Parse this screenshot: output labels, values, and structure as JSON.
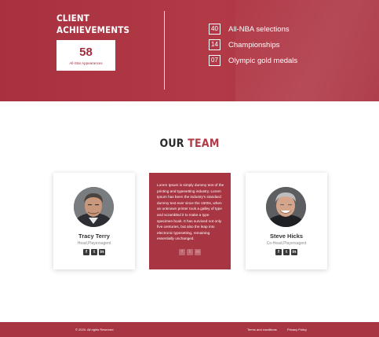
{
  "achievements": {
    "title": "CLIENT ACHIEVEMENTS",
    "highlight": {
      "number": "58",
      "label": "All-Star Appearances"
    },
    "stats": [
      {
        "number": "40",
        "label": "All-NBA selections"
      },
      {
        "number": "14",
        "label": "Championships"
      },
      {
        "number": "07",
        "label": "Olympic gold medals"
      }
    ]
  },
  "team": {
    "heading_part1": "OUR",
    "heading_part2": "TEAM",
    "members": [
      {
        "name": "Tracy Terry",
        "role": "Head,Playersagent"
      },
      {
        "name": "Steve Hicks",
        "role": "Co-Head,Playersagent"
      }
    ],
    "bio": "Lorem Ipsum is simply dummy text of the printing and typesetting industry. Lorem Ipsum has been the industry's standard dummy text ever since the 1500s, when an unknown printer took a galley of type and scrambled it to make a type specimen book. It has survived not only five centuries, but also the leap into electronic typesetting, remaining essentially unchanged.",
    "social_icons": [
      "facebook-icon",
      "twitter-icon",
      "linkedin-icon"
    ]
  },
  "footer": {
    "copyright": "© 2020. All rights Reserved",
    "terms": "Terms and conditions",
    "privacy": "Privacy Policy"
  },
  "colors": {
    "brand": "#a83542",
    "dark_text": "#2b2b2b"
  }
}
